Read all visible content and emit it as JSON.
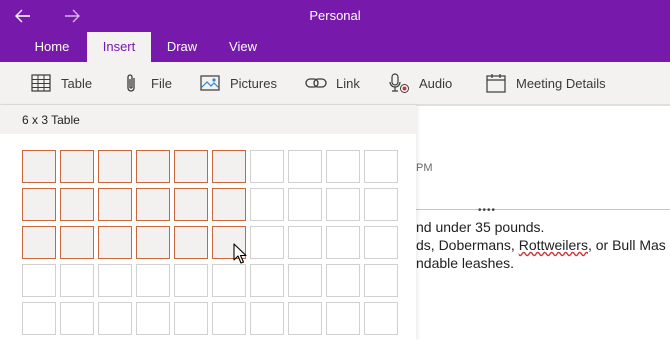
{
  "window": {
    "title": "Personal"
  },
  "tabs": [
    {
      "label": "Home",
      "active": false
    },
    {
      "label": "Insert",
      "active": true
    },
    {
      "label": "Draw",
      "active": false
    },
    {
      "label": "View",
      "active": false
    }
  ],
  "ribbon": {
    "table": "Table",
    "file": "File",
    "pictures": "Pictures",
    "link": "Link",
    "audio": "Audio",
    "meeting": "Meeting Details"
  },
  "picker": {
    "label": "6 x 3 Table",
    "columns": 10,
    "rows": 5,
    "selected_columns": 6,
    "selected_rows": 3
  },
  "page": {
    "timestamp": "PM",
    "line1": "nd under 35 pounds.",
    "line2_start": "ds, Dobermans, ",
    "line2_misspelled": "Rottweilers",
    "line2_end": ", or Bull Mas",
    "line3": "ndable leashes."
  },
  "colors": {
    "brand": "#7719aa",
    "selection_border": "#c8683c",
    "spelling_error": "#d13438"
  }
}
